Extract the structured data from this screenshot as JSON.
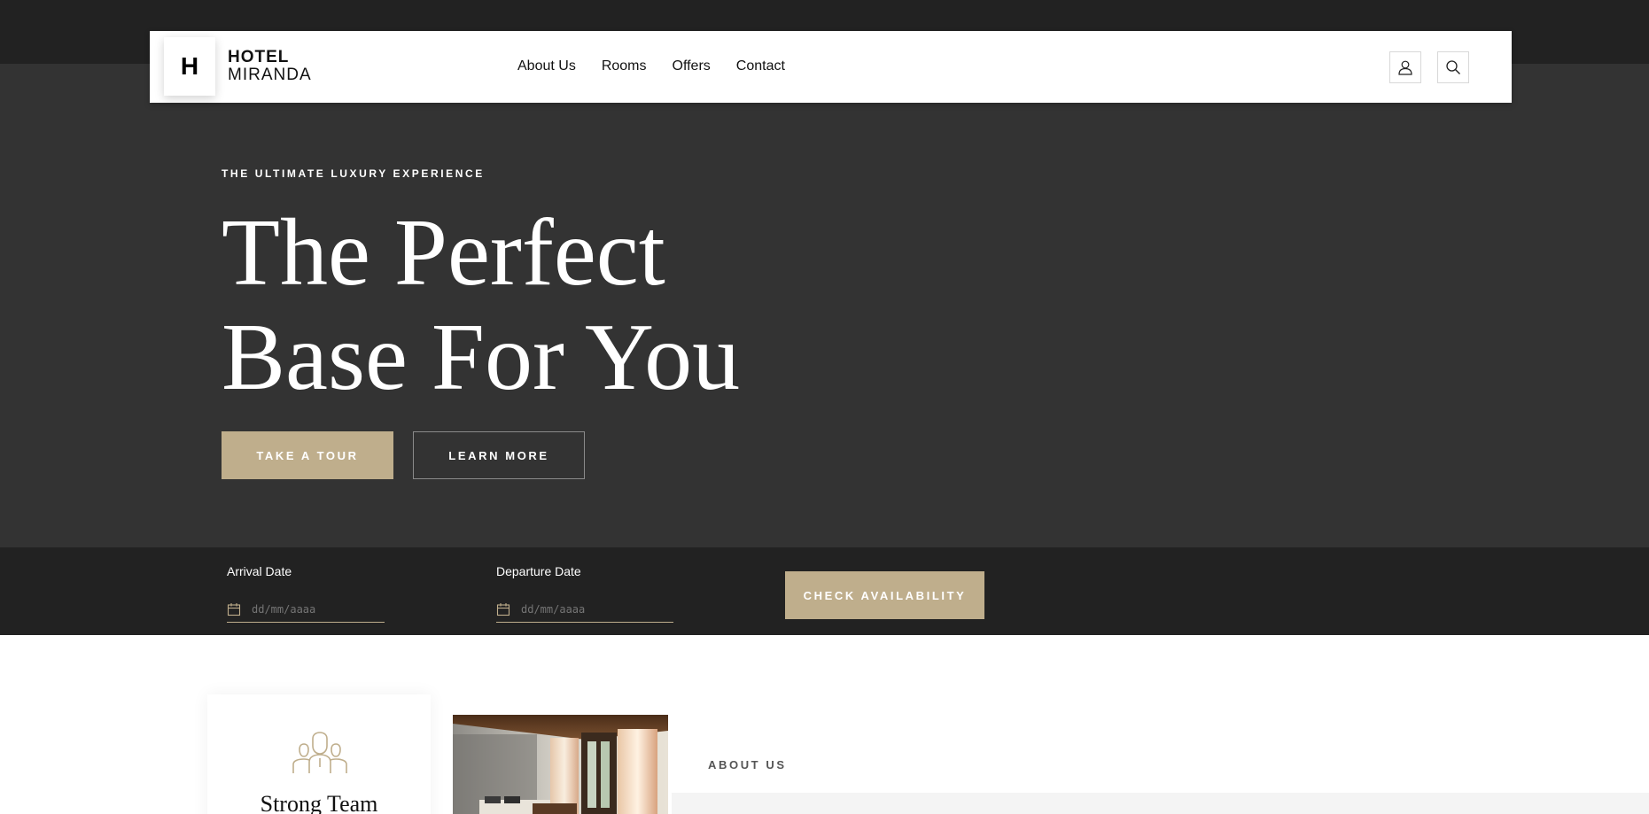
{
  "colors": {
    "accent": "#bfae8c",
    "hero_bg": "#333333",
    "top_band_bg": "#222222",
    "booking_bg": "#222222",
    "white": "#ffffff"
  },
  "header": {
    "logo_mark": "H",
    "logo_line1": "HOTEL",
    "logo_line2": "MIRANDA",
    "nav": [
      {
        "label": "About Us"
      },
      {
        "label": "Rooms"
      },
      {
        "label": "Offers"
      },
      {
        "label": "Contact"
      }
    ],
    "icons": [
      "user-icon",
      "search-icon"
    ]
  },
  "hero": {
    "eyebrow": "THE ULTIMATE LUXURY EXPERIENCE",
    "headline_line1": "The Perfect",
    "headline_line2": "Base For You",
    "primary_button": "TAKE A TOUR",
    "secondary_button": "LEARN MORE"
  },
  "booking": {
    "arrival_label": "Arrival Date",
    "arrival_placeholder": "dd/mm/aaaa",
    "departure_label": "Departure Date",
    "departure_placeholder": "dd/mm/aaaa",
    "check_button": "CHECK AVAILABILITY"
  },
  "features": {
    "card_title": "Strong Team",
    "card_icon": "team-icon"
  },
  "about": {
    "label": "ABOUT US"
  }
}
